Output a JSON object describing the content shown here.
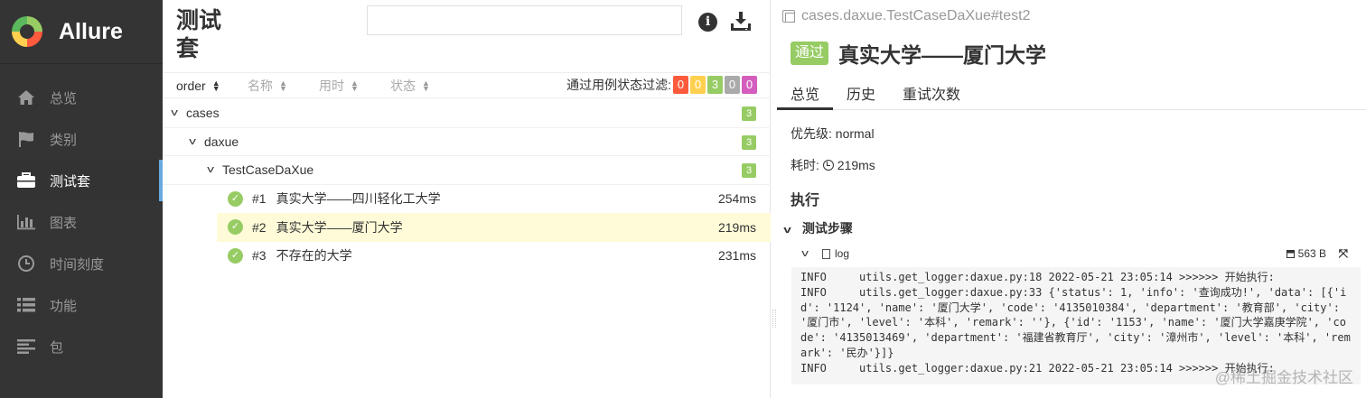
{
  "app": {
    "name": "Allure"
  },
  "sidebar": {
    "items": [
      {
        "label": "总览",
        "icon": "home-icon"
      },
      {
        "label": "类别",
        "icon": "flag-icon"
      },
      {
        "label": "测试套",
        "icon": "briefcase-icon",
        "active": true
      },
      {
        "label": "图表",
        "icon": "bar-chart-icon"
      },
      {
        "label": "时间刻度",
        "icon": "clock-icon"
      },
      {
        "label": "功能",
        "icon": "list-icon"
      },
      {
        "label": "包",
        "icon": "align-left-icon"
      }
    ]
  },
  "suites": {
    "title": "测试套",
    "search": {
      "value": "",
      "placeholder": ""
    },
    "sort": {
      "order": "order",
      "name": "名称",
      "duration": "用时",
      "status": "状态"
    },
    "filter": {
      "label": "通过用例状态过滤:",
      "badges": [
        {
          "value": "0",
          "color": "#fd5a3e"
        },
        {
          "value": "0",
          "color": "#ffd050"
        },
        {
          "value": "3",
          "color": "#97cc64"
        },
        {
          "value": "0",
          "color": "#aaaaaa"
        },
        {
          "value": "0",
          "color": "#d35ebe"
        }
      ]
    },
    "tree": {
      "groups": [
        {
          "name": "cases",
          "count": "3"
        },
        {
          "name": "daxue",
          "count": "3"
        },
        {
          "name": "TestCaseDaXue",
          "count": "3"
        }
      ],
      "cases": [
        {
          "num": "#1",
          "name": "真实大学——四川轻化工大学",
          "duration": "254ms"
        },
        {
          "num": "#2",
          "name": "真实大学——厦门大学",
          "duration": "219ms"
        },
        {
          "num": "#3",
          "name": "不存在的大学",
          "duration": "231ms"
        }
      ]
    }
  },
  "detail": {
    "path": "cases.daxue.TestCaseDaXue#test2",
    "status": "通过",
    "title": "真实大学——厦门大学",
    "tabs": [
      "总览",
      "历史",
      "重试次数"
    ],
    "priority_label": "优先级:",
    "priority": "normal",
    "duration_label": "耗时:",
    "duration": "219ms",
    "execution_label": "执行",
    "steps_label": "测试步骤",
    "attachment": {
      "name": "log",
      "size": "563 B"
    },
    "log_lines": [
      "INFO     utils.get_logger:daxue.py:18 2022-05-21 23:05:14 >>>>>> 开始执行:",
      "INFO     utils.get_logger:daxue.py:33 {'status': 1, 'info': '查询成功!', 'data': [{'id': '1124', 'name': '厦门大学', 'code': '4135010384', 'department': '教育部', 'city': '厦门市', 'level': '本科', 'remark': ''}, {'id': '1153', 'name': '厦门大学嘉庚学院', 'code': '4135013469', 'department': '福建省教育厅', 'city': '漳州市', 'level': '本科', 'remark': '民办'}]}",
      "INFO     utils.get_logger:daxue.py:21 2022-05-21 23:05:14 >>>>>> 开始执行:"
    ]
  },
  "watermark": "@稀土掘金技术社区"
}
